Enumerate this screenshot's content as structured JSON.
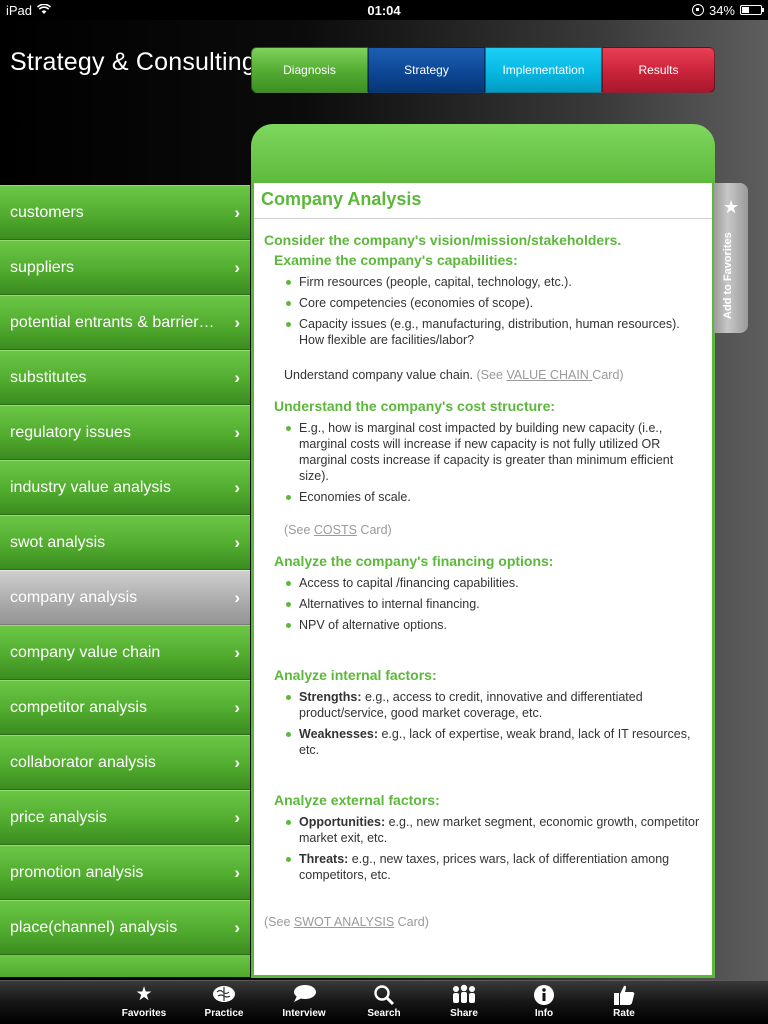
{
  "status_bar": {
    "device": "iPad",
    "time": "01:04",
    "battery": "34%"
  },
  "app_title": "Strategy & Consulting",
  "tabs": [
    {
      "label": "Diagnosis"
    },
    {
      "label": "Strategy"
    },
    {
      "label": "Implementation"
    },
    {
      "label": "Results"
    }
  ],
  "sidebar": {
    "items": [
      {
        "label": "customers"
      },
      {
        "label": "suppliers"
      },
      {
        "label": "potential entrants & barrier…"
      },
      {
        "label": "substitutes"
      },
      {
        "label": "regulatory issues"
      },
      {
        "label": "industry value analysis"
      },
      {
        "label": "swot analysis"
      },
      {
        "label": "company analysis"
      },
      {
        "label": "company value chain"
      },
      {
        "label": "competitor analysis"
      },
      {
        "label": "collaborator analysis"
      },
      {
        "label": "price analysis"
      },
      {
        "label": "promotion analysis"
      },
      {
        "label": "place(channel) analysis"
      }
    ],
    "active_index": 7
  },
  "favorites_tab": {
    "label": "Add to Favorites"
  },
  "content": {
    "title": "Company Analysis",
    "intro": "Consider the company's vision/mission/stakeholders.",
    "sec1": {
      "heading": "Examine the company's capabilities:",
      "b1": "Firm resources (people, capital, technology, etc.).",
      "b2": "Core competencies (economies of scope).",
      "b3": "Capacity issues (e.g., manufacturing, distribution, human resources). How flexible are facilities/labor?",
      "note": "Understand company value chain.",
      "see_pre": "(See ",
      "see_link": "VALUE CHAIN ",
      "see_post": "Card)"
    },
    "sec2": {
      "heading": "Understand the company's cost structure:",
      "b1": "E.g., how is marginal cost impacted by building new capacity (i.e., marginal costs will increase if new capacity is not fully utilized OR marginal costs increase if capacity is greater than minimum efficient size).",
      "b2": "Economies of scale.",
      "see_pre": "(See ",
      "see_link": "COSTS",
      "see_post": " Card)"
    },
    "sec3": {
      "heading": "Analyze the company's financing options:",
      "b1": "Access to capital /financing capabilities.",
      "b2": "Alternatives to internal financing.",
      "b3": "NPV of alternative options."
    },
    "sec4": {
      "heading": "Analyze internal factors:",
      "k1": "Strengths:",
      "v1": " e.g., access to credit, innovative and differentiated product/service, good market coverage, etc.",
      "k2": "Weaknesses:",
      "v2": " e.g., lack of expertise, weak brand, lack of IT resources, etc."
    },
    "sec5": {
      "heading": "Analyze external factors:",
      "k1": "Opportunities:",
      "v1": " e.g., new market segment, economic growth, competitor market exit, etc.",
      "k2": "Threats:",
      "v2": " e.g., new taxes, prices wars, lack of differentiation among competitors, etc."
    },
    "footer_see": {
      "pre": "(See ",
      "link": "SWOT ANALYSIS",
      "post": " Card)"
    }
  },
  "toolbar": [
    {
      "label": "Favorites",
      "icon": "star-icon"
    },
    {
      "label": "Practice",
      "icon": "brain-icon"
    },
    {
      "label": "Interview",
      "icon": "chat-bubble-icon"
    },
    {
      "label": "Search",
      "icon": "search-icon"
    },
    {
      "label": "Share",
      "icon": "people-icon"
    },
    {
      "label": "Info",
      "icon": "info-icon"
    },
    {
      "label": "Rate",
      "icon": "thumbs-up-icon"
    }
  ]
}
